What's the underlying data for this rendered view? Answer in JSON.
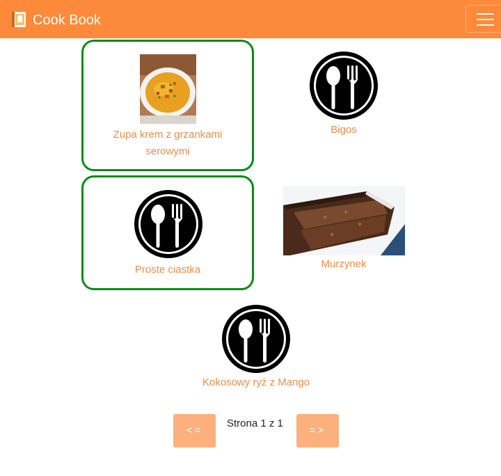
{
  "app": {
    "title": "Cook Book"
  },
  "recipes": [
    {
      "name": "Zupa krem z grzankami serowymi",
      "favorite": true,
      "image": "soup-photo"
    },
    {
      "name": "Bigos",
      "favorite": false,
      "image": "cutlery-icon"
    },
    {
      "name": "Proste ciastka",
      "favorite": true,
      "image": "cutlery-icon"
    },
    {
      "name": "Murzynek",
      "favorite": false,
      "image": "cake-photo"
    },
    {
      "name": "Kokosowy ryż z Mango",
      "favorite": false,
      "image": "cutlery-icon"
    }
  ],
  "pagination": {
    "prev_label": "<=",
    "next_label": "=>",
    "status": "Strona 1 z 1"
  },
  "colors": {
    "navbar": "#fd8a3a",
    "favorite_border": "#0a8a16",
    "recipe_label": "#ef8c45",
    "pager_button": "#fbb07e"
  }
}
